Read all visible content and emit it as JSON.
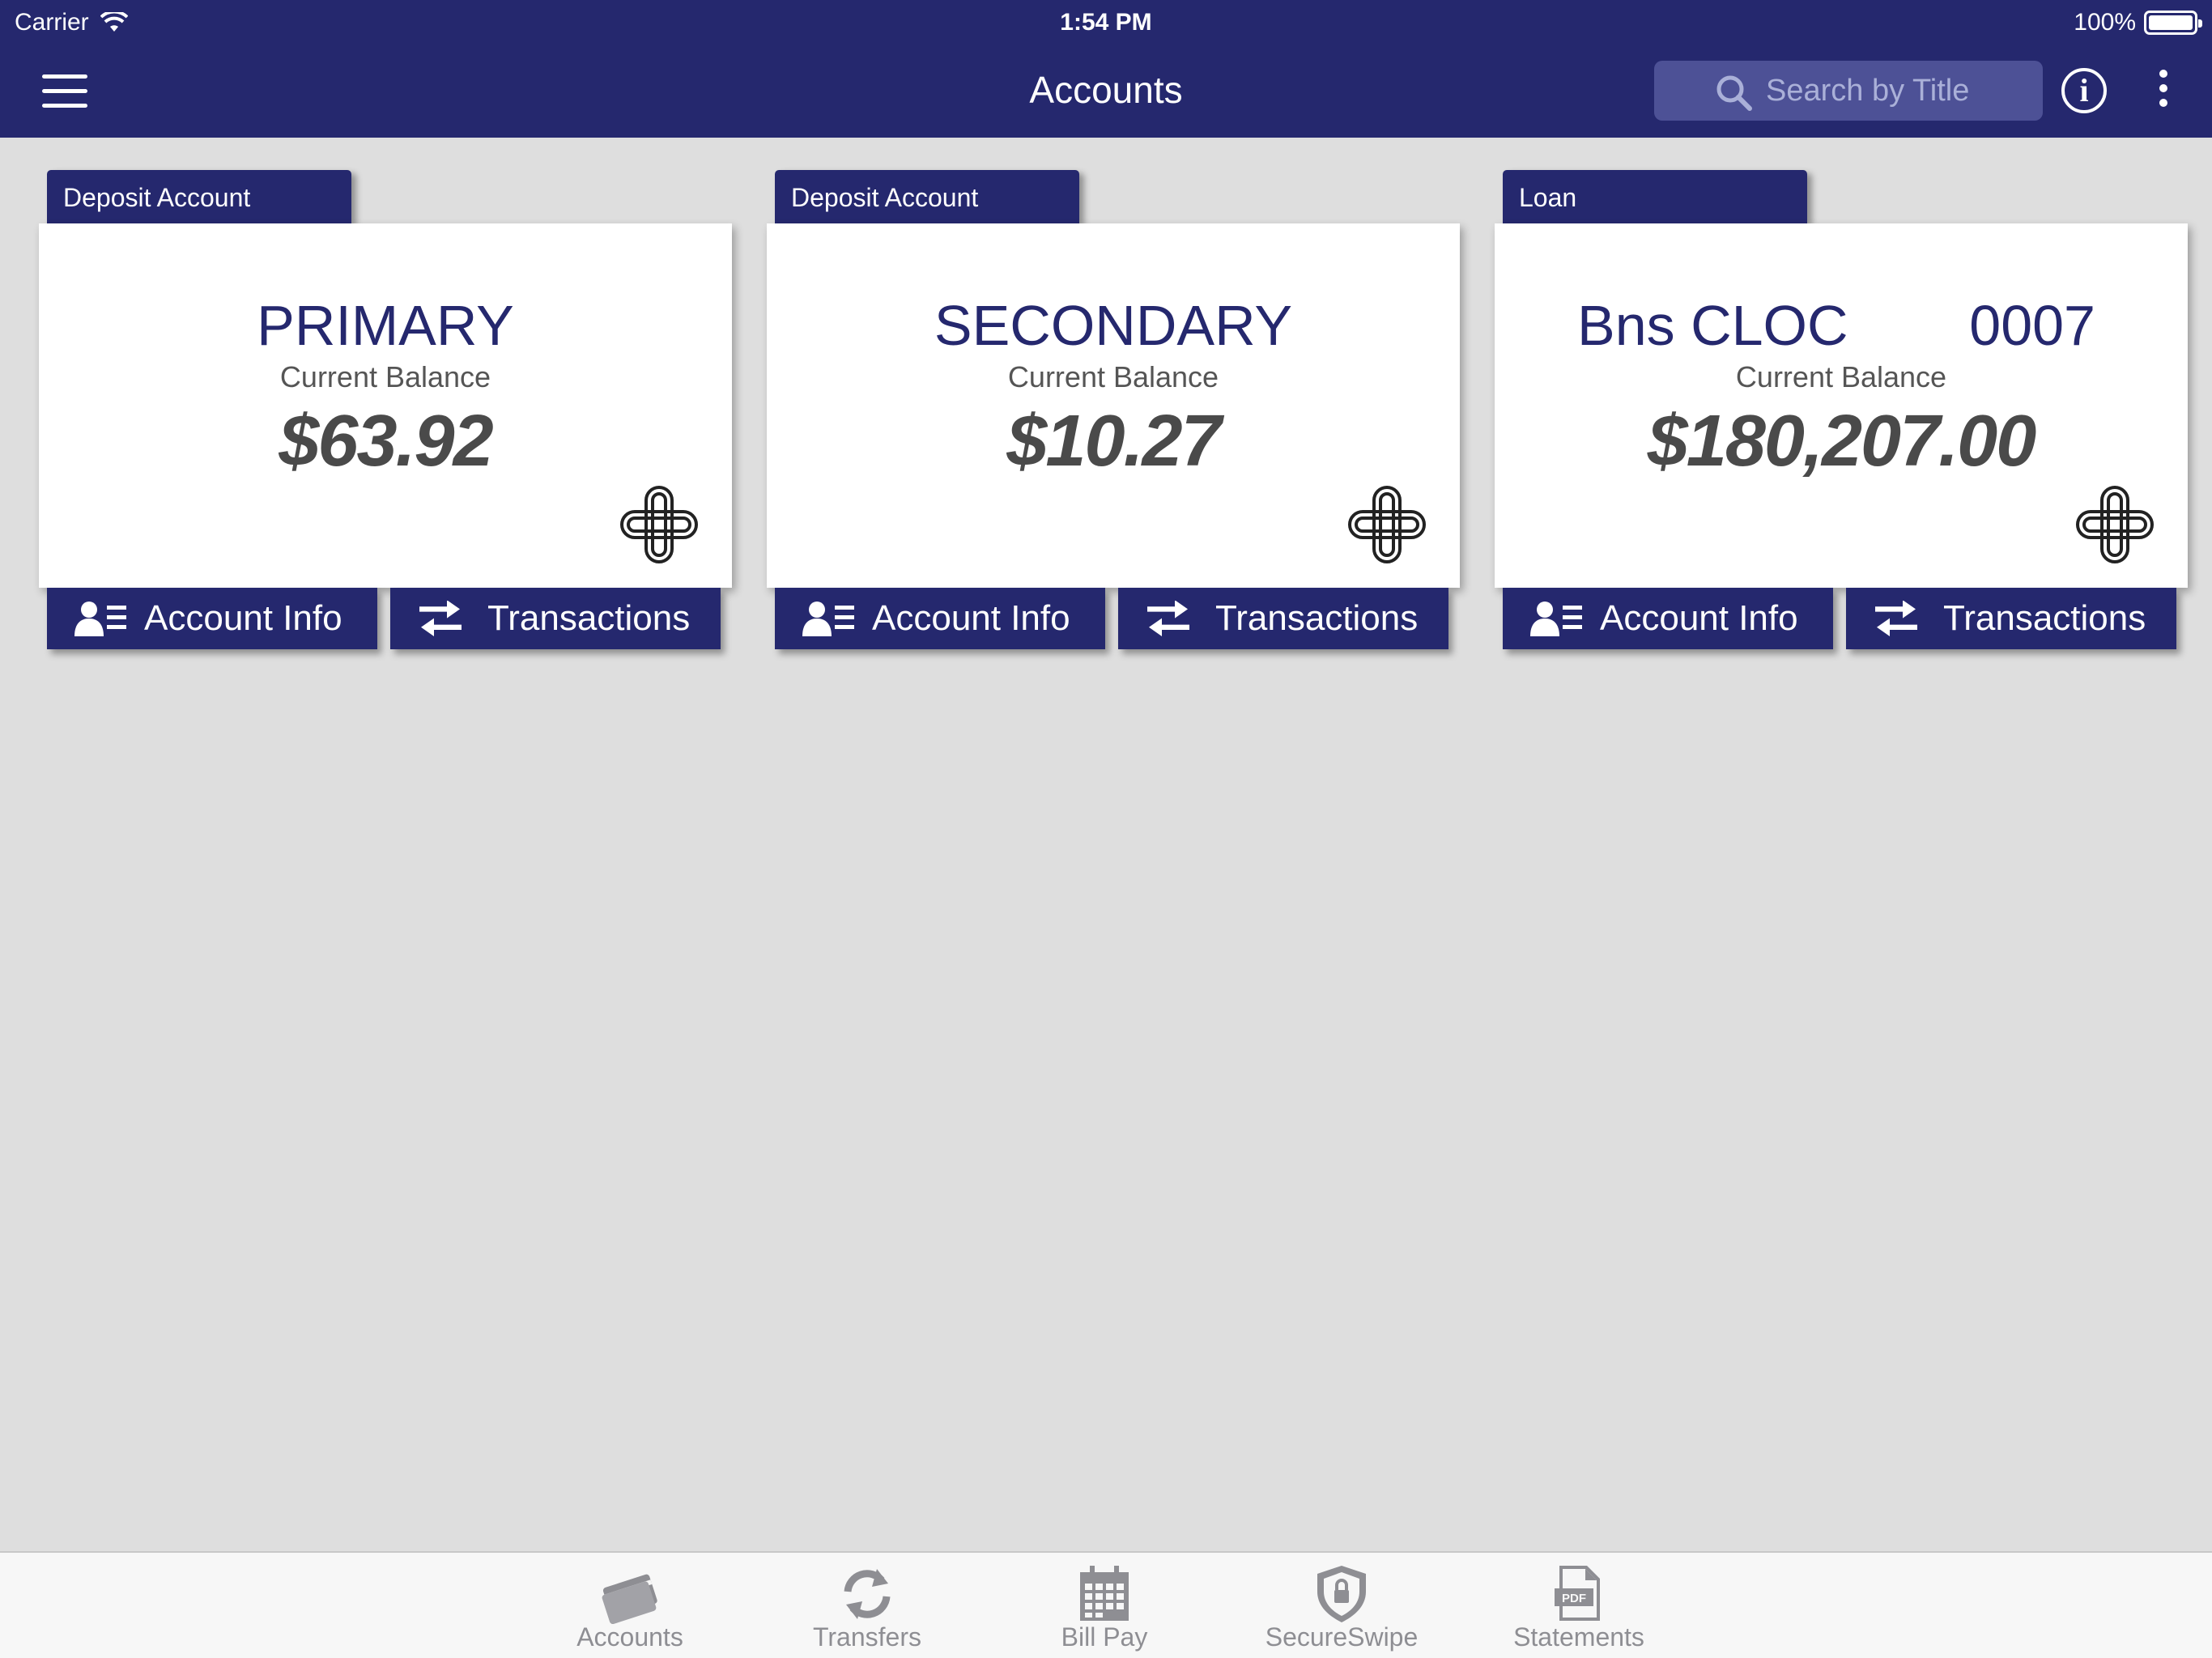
{
  "status": {
    "carrier": "Carrier",
    "time": "1:54 PM",
    "battery": "100%",
    "battery_level": 1.0
  },
  "nav": {
    "title": "Accounts",
    "search_placeholder": "Search by Title",
    "info_label": "i"
  },
  "colors": {
    "brand": "#25286e",
    "background": "#dedede",
    "tab_inactive": "#8e8e93"
  },
  "accounts": [
    {
      "type": "Deposit Account",
      "name": "PRIMARY",
      "number": "",
      "balance_label": "Current Balance",
      "balance": "$63.92",
      "info_label": "Account Info",
      "transactions_label": "Transactions"
    },
    {
      "type": "Deposit Account",
      "name": "SECONDARY",
      "number": "",
      "balance_label": "Current Balance",
      "balance": "$10.27",
      "info_label": "Account Info",
      "transactions_label": "Transactions"
    },
    {
      "type": "Loan",
      "name": "Bns CLOC",
      "number": "0007",
      "balance_label": "Current Balance",
      "balance": "$180,207.00",
      "info_label": "Account Info",
      "transactions_label": "Transactions"
    }
  ],
  "tabs": [
    {
      "label": "Accounts",
      "icon": "credit-card-icon"
    },
    {
      "label": "Transfers",
      "icon": "refresh-icon"
    },
    {
      "label": "Bill Pay",
      "icon": "calendar-icon"
    },
    {
      "label": "SecureSwipe",
      "icon": "shield-lock-icon"
    },
    {
      "label": "Statements",
      "icon": "pdf-icon"
    }
  ]
}
